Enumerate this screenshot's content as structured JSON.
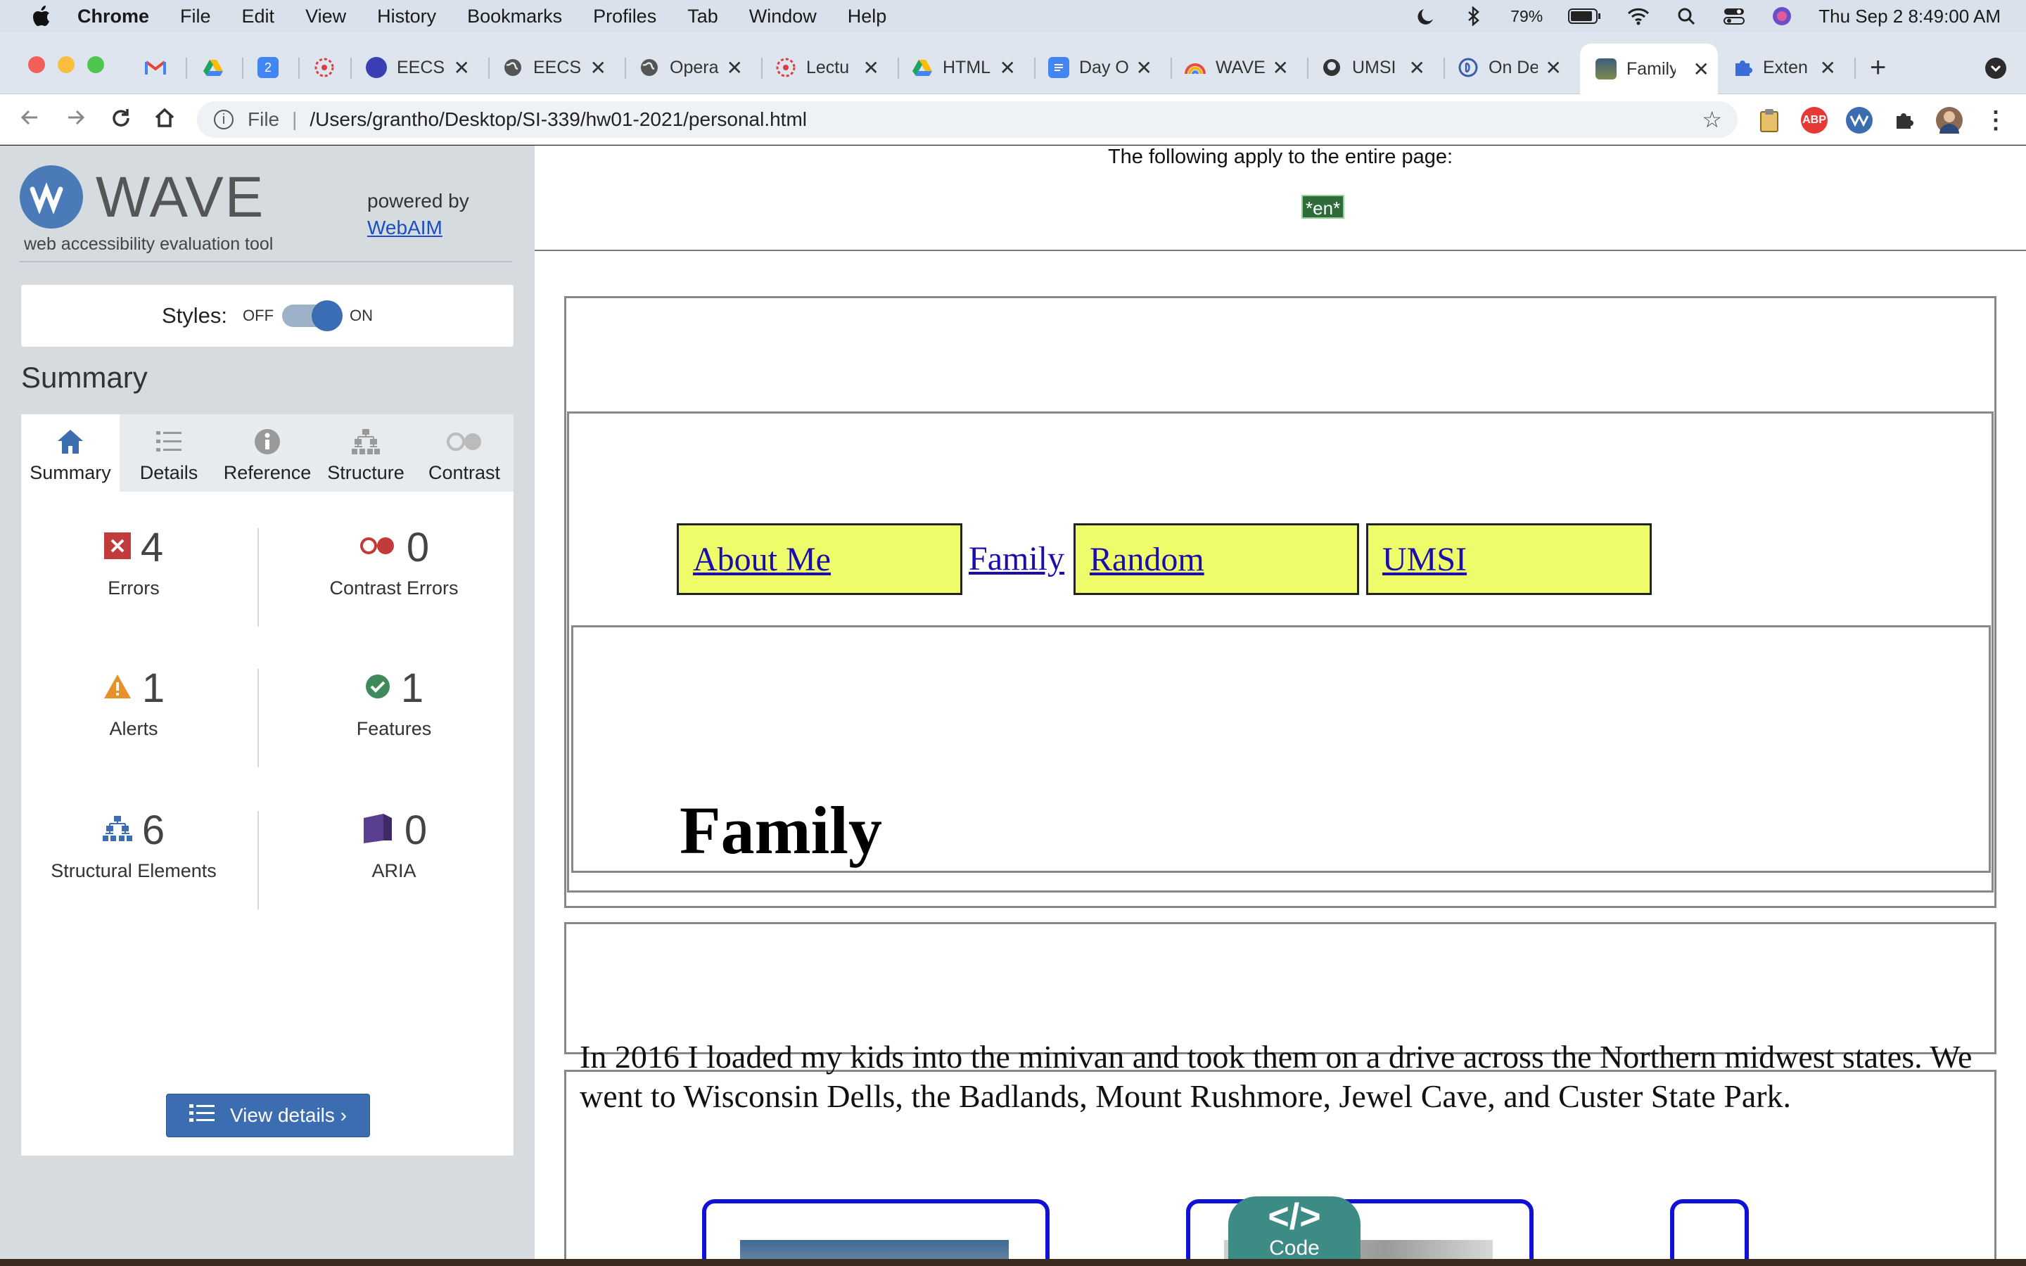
{
  "menubar": {
    "app": "Chrome",
    "items": [
      "File",
      "Edit",
      "View",
      "History",
      "Bookmarks",
      "Profiles",
      "Tab",
      "Window",
      "Help"
    ],
    "battery": "79%",
    "clock": "Thu Sep 2  8:49:00 AM"
  },
  "tabs": [
    {
      "title": "",
      "icon": "gmail-icon",
      "color": "#ea4335"
    },
    {
      "title": "",
      "icon": "google-drive-icon",
      "color": "#1fa463"
    },
    {
      "title": "",
      "icon": "google-calendar-icon",
      "color": "#4285f4"
    },
    {
      "title": "",
      "icon": "umich-canvas-icon",
      "color": "#e13c3c"
    },
    {
      "title": "EECS",
      "icon": "eecs-icon",
      "color": "#3b3fb6"
    },
    {
      "title": "EECS",
      "icon": "globe-icon",
      "color": "#555555"
    },
    {
      "title": "Opera",
      "icon": "globe-icon",
      "color": "#555555"
    },
    {
      "title": "Lectu",
      "icon": "umich-canvas-icon",
      "color": "#e13c3c"
    },
    {
      "title": "HTML",
      "icon": "google-drive-icon",
      "color": "#1fa463"
    },
    {
      "title": "Day O",
      "icon": "google-docs-icon",
      "color": "#4285f4"
    },
    {
      "title": "WAVE",
      "icon": "wave-icon",
      "color": "#e8a33c"
    },
    {
      "title": "UMSI",
      "icon": "github-icon",
      "color": "#333333"
    },
    {
      "title": "On De",
      "icon": "ondemand-icon",
      "color": "#3a5ea8"
    },
    {
      "title": "Family",
      "icon": "family-photo-icon",
      "color": "#6b7b4a"
    },
    {
      "title": "Exten",
      "icon": "puzzle-icon",
      "color": "#3a6cd8"
    }
  ],
  "address": {
    "scheme": "File",
    "path": "/Users/grantho/Desktop/SI-339/hw01-2021/personal.html"
  },
  "wave": {
    "title": "WAVE",
    "subtitle": "web accessibility evaluation tool",
    "powered_by": "powered by",
    "powered_link": "WebAIM",
    "styles_label": "Styles:",
    "styles_off": "OFF",
    "styles_on": "ON",
    "styles_enabled": true,
    "summary_heading": "Summary",
    "tabs": [
      "Summary",
      "Details",
      "Reference",
      "Structure",
      "Contrast"
    ],
    "stats": {
      "errors": {
        "value": "4",
        "label": "Errors"
      },
      "contrast": {
        "value": "0",
        "label": "Contrast Errors"
      },
      "alerts": {
        "value": "1",
        "label": "Alerts"
      },
      "features": {
        "value": "1",
        "label": "Features"
      },
      "structure": {
        "value": "6",
        "label": "Structural Elements"
      },
      "aria": {
        "value": "0",
        "label": "ARIA"
      }
    },
    "view_details": "View details ›"
  },
  "page": {
    "applies_text": "The following apply to the entire page:",
    "lang_badge": "*en*",
    "nav": {
      "about": "About Me",
      "family": "Family",
      "random": "Random",
      "umsi": "UMSI"
    },
    "heading": "Family",
    "paragraph": "In 2016 I loaded my kids into the minivan and took them on a drive across the Northern midwest states. We went to Wisconsin Dells, the Badlands, Mount Rushmore, Jewel Cave, and Custer State Park.",
    "code_badge": "Code",
    "code_symbol": "</>"
  }
}
